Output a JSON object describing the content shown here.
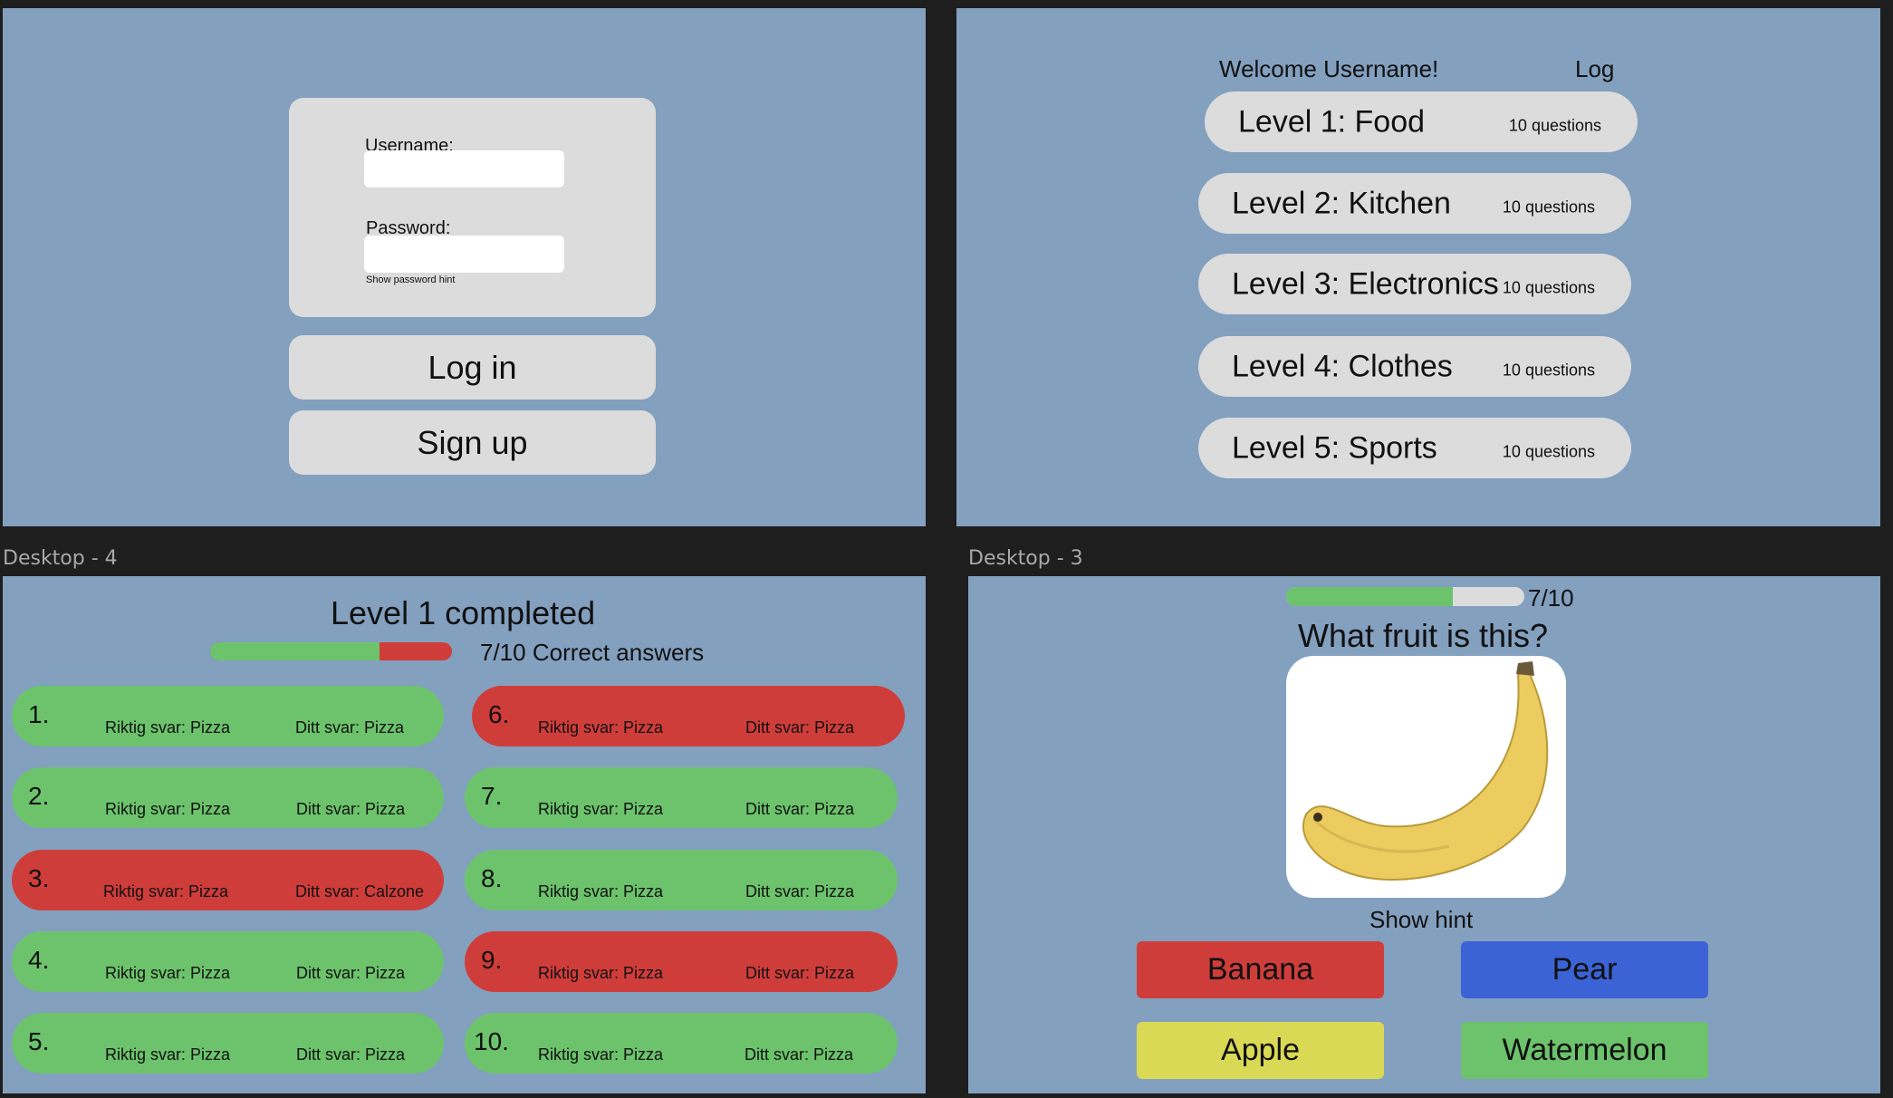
{
  "frames": {
    "top_left_label": "",
    "top_right_label": "",
    "bottom_left_label": "Desktop - 4",
    "bottom_right_label": "Desktop - 3"
  },
  "login": {
    "username_label": "Username:",
    "username_value": "",
    "password_label": "Password:",
    "password_value": "",
    "show_hint_link": "Show password hint",
    "login_button": "Log in",
    "signup_button": "Sign up"
  },
  "levels": {
    "welcome": "Welcome Username!",
    "log_link": "Log",
    "items": [
      {
        "name": "Level 1: Food",
        "questions": "10 questions"
      },
      {
        "name": "Level 2: Kitchen",
        "questions": "10 questions"
      },
      {
        "name": "Level 3: Electronics",
        "questions": "10 questions"
      },
      {
        "name": "Level 4: Clothes",
        "questions": "10 questions"
      },
      {
        "name": "Level 5: Sports",
        "questions": "10 questions"
      }
    ]
  },
  "results": {
    "title": "Level 1 completed",
    "correct_text": "7/10 Correct answers",
    "score_fraction": 0.7,
    "colors": {
      "correct": "#6cc36c",
      "wrong": "#cf3d3a"
    },
    "rows": [
      {
        "num": "1.",
        "correct": "Riktig svar: Pizza",
        "yours": "Ditt svar: Pizza",
        "status": "correct"
      },
      {
        "num": "2.",
        "correct": "Riktig svar: Pizza",
        "yours": "Ditt svar: Pizza",
        "status": "correct"
      },
      {
        "num": "3.",
        "correct": "Riktig svar: Pizza",
        "yours": "Ditt svar: Calzone",
        "status": "wrong"
      },
      {
        "num": "4.",
        "correct": "Riktig svar: Pizza",
        "yours": "Ditt svar: Pizza",
        "status": "correct"
      },
      {
        "num": "5.",
        "correct": "Riktig svar: Pizza",
        "yours": "Ditt svar: Pizza",
        "status": "correct"
      },
      {
        "num": "6.",
        "correct": "Riktig svar: Pizza",
        "yours": "Ditt svar: Pizza",
        "status": "wrong"
      },
      {
        "num": "7.",
        "correct": "Riktig svar: Pizza",
        "yours": "Ditt svar: Pizza",
        "status": "correct"
      },
      {
        "num": "8.",
        "correct": "Riktig svar: Pizza",
        "yours": "Ditt svar: Pizza",
        "status": "correct"
      },
      {
        "num": "9.",
        "correct": "Riktig svar: Pizza",
        "yours": "Ditt svar: Pizza",
        "status": "wrong"
      },
      {
        "num": "10.",
        "correct": "Riktig svar: Pizza",
        "yours": "Ditt svar: Pizza",
        "status": "correct"
      }
    ]
  },
  "quiz": {
    "progress_text": "7/10",
    "progress_fraction": 0.7,
    "question": "What fruit is this?",
    "image_icon": "banana-image",
    "hint_link": "Show hint",
    "answers": [
      {
        "label": "Banana",
        "color": "#cf3d3a"
      },
      {
        "label": "Pear",
        "color": "#3b63d6"
      },
      {
        "label": "Apple",
        "color": "#d9d956"
      },
      {
        "label": "Watermelon",
        "color": "#6cc36c"
      }
    ]
  }
}
